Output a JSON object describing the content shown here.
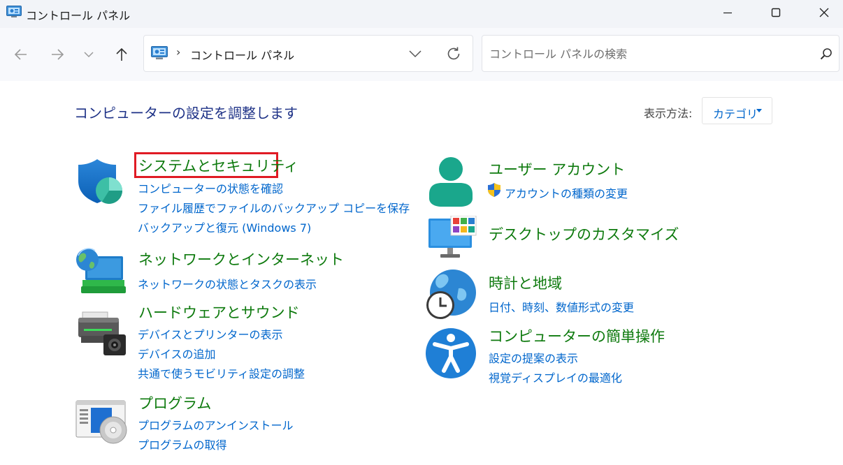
{
  "window": {
    "title": "コントロール パネル"
  },
  "address": {
    "separator": "›",
    "path": "コントロール パネル"
  },
  "search": {
    "placeholder": "コントロール パネルの検索"
  },
  "page": {
    "title": "コンピューターの設定を調整します",
    "view_label": "表示方法:",
    "view_value": "カテゴリ"
  },
  "categories": {
    "system": {
      "title": "システムとセキュリティ",
      "links": [
        "コンピューターの状態を確認",
        "ファイル履歴でファイルのバックアップ コピーを保存",
        "バックアップと復元 (Windows 7)"
      ]
    },
    "network": {
      "title": "ネットワークとインターネット",
      "links": [
        "ネットワークの状態とタスクの表示"
      ]
    },
    "hardware": {
      "title": "ハードウェアとサウンド",
      "links": [
        "デバイスとプリンターの表示",
        "デバイスの追加",
        "共通で使うモビリティ設定の調整"
      ]
    },
    "programs": {
      "title": "プログラム",
      "links": [
        "プログラムのアンインストール",
        "プログラムの取得"
      ]
    },
    "users": {
      "title": "ユーザー アカウント",
      "links": [
        "アカウントの種類の変更"
      ]
    },
    "appearance": {
      "title": "デスクトップのカスタマイズ",
      "links": []
    },
    "clock": {
      "title": "時計と地域",
      "links": [
        "日付、時刻、数値形式の変更"
      ]
    },
    "ease": {
      "title": "コンピューターの簡単操作",
      "links": [
        "設定の提案の表示",
        "視覚ディスプレイの最適化"
      ]
    }
  },
  "colors": {
    "link": "#0066cc",
    "category_title": "#0e7a0e",
    "page_title": "#1e3287",
    "highlight": "#e01b24"
  }
}
